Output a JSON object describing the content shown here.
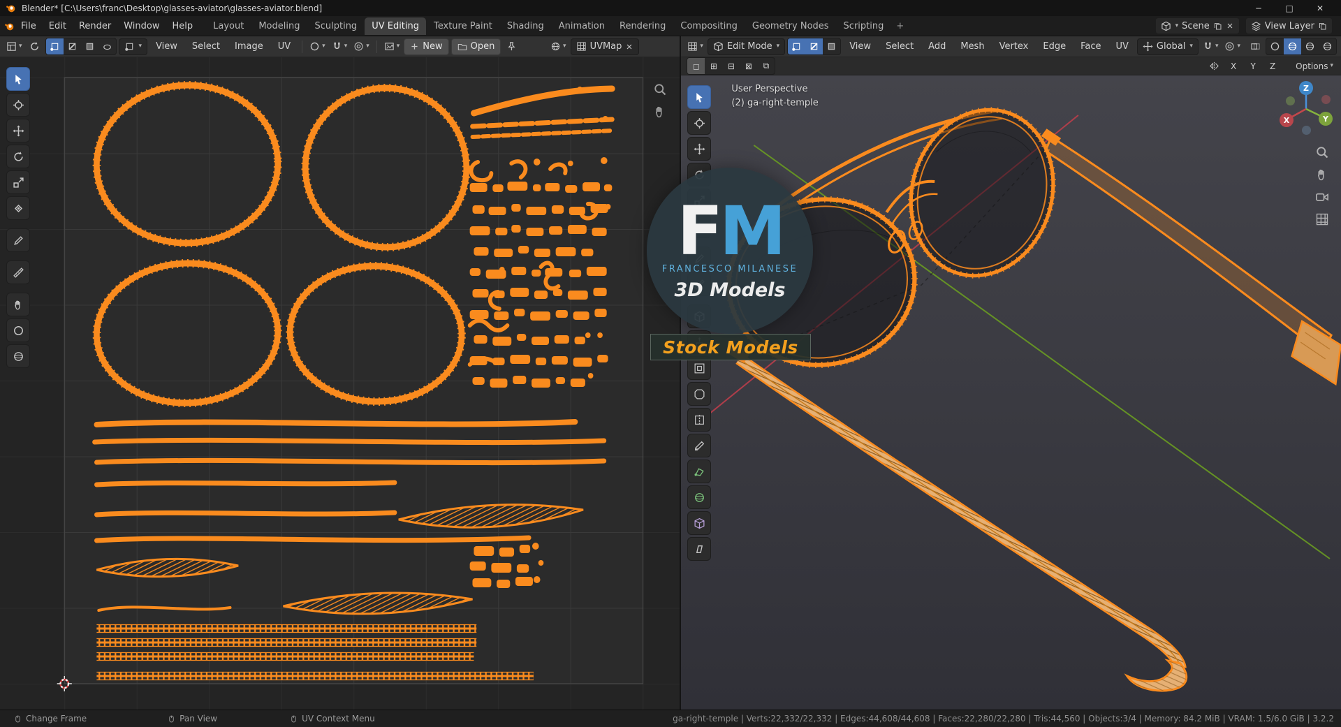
{
  "window": {
    "title": "Blender* [C:\\Users\\franc\\Desktop\\glasses-aviator\\glasses-aviator.blend]",
    "minimize": "─",
    "maximize": "□",
    "close": "✕"
  },
  "icons": {
    "caret": "▾",
    "select_set": "◻",
    "select_extend": "⊞",
    "select_subtract": "⊟",
    "select_invert": "⊠",
    "select_intersect": "⧉"
  },
  "topbar": {
    "menus": [
      "File",
      "Edit",
      "Render",
      "Window",
      "Help"
    ],
    "workspaces": [
      "Layout",
      "Modeling",
      "Sculpting",
      "UV Editing",
      "Texture Paint",
      "Shading",
      "Animation",
      "Rendering",
      "Compositing",
      "Geometry Nodes",
      "Scripting"
    ],
    "active_workspace": "UV Editing",
    "new_workspace": "+",
    "scene": "Scene",
    "view_layer": "View Layer"
  },
  "uv": {
    "menus": [
      "View",
      "Select",
      "Image",
      "UV"
    ],
    "new": "New",
    "open": "Open",
    "uv_map": "UVMap"
  },
  "vp": {
    "mode": "Edit Mode",
    "menus": [
      "View",
      "Select",
      "Add",
      "Mesh",
      "Vertex",
      "Edge",
      "Face",
      "UV"
    ],
    "orientation": "Global",
    "options": "Options",
    "mirror": [
      "X",
      "Y",
      "Z"
    ],
    "overlay_perspective": "User Perspective",
    "overlay_object": "(2) ga-right-temple",
    "gizmo": {
      "x": "X",
      "y": "Y",
      "z": "Z"
    }
  },
  "watermark": {
    "f": "F",
    "m": "M",
    "name": "FRANCESCO MILANESE",
    "tagline": "3D Models",
    "banner": "Stock Models"
  },
  "statusbar": {
    "hints": [
      "Change Frame",
      "Pan View",
      "UV Context Menu"
    ],
    "stats": "ga-right-temple | Verts:22,332/22,332 | Edges:44,608/44,608 | Faces:22,280/22,280 | Tris:44,560 | Objects:3/4 | Memory: 84.2 MiB | VRAM: 1.5/6.0 GiB | 3.2.2"
  },
  "colors": {
    "selection_orange": "#fa8b1e",
    "active_tool_blue": "#4772b3",
    "logo_blue": "#46a1d7",
    "banner_gold": "#f3a01e",
    "axis_red": "#bb3e4b",
    "axis_green": "#6a9c22"
  }
}
